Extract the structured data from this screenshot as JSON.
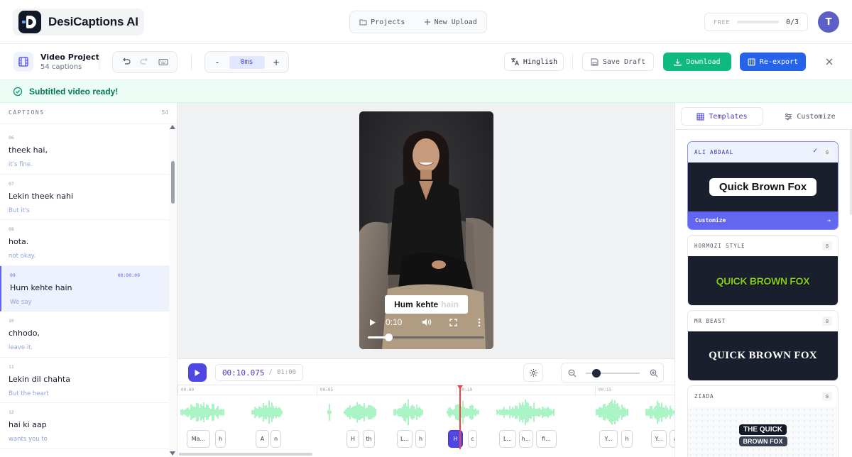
{
  "brand": {
    "name": "DesiCaptions AI"
  },
  "nav": {
    "projects": "Projects",
    "new_upload": "New Upload"
  },
  "quota": {
    "plan": "FREE",
    "count": "0/3",
    "used_fraction": 0
  },
  "user": {
    "initial": "T"
  },
  "project": {
    "title": "Video Project",
    "subtitle": "54 captions"
  },
  "offset": {
    "minus": "-",
    "value": "0ms",
    "plus": "+"
  },
  "toolbar": {
    "language": "Hinglish",
    "save_draft": "Save Draft",
    "download": "Download",
    "reexport": "Re-export"
  },
  "banner": {
    "text": "Subtitled video ready!"
  },
  "captions": {
    "header": "CAPTIONS",
    "count": "54",
    "items": [
      {
        "num": "06",
        "text": "theek hai,",
        "translation": "it's fine.",
        "time": "",
        "active": false
      },
      {
        "num": "07",
        "text": "Lekin theek nahi",
        "translation": "But it's",
        "time": "",
        "active": false
      },
      {
        "num": "08",
        "text": "hota.",
        "translation": "not okay.",
        "time": "",
        "active": false
      },
      {
        "num": "09",
        "text": "Hum kehte hain",
        "translation": "We say",
        "time": "00:00:09",
        "active": true
      },
      {
        "num": "10",
        "text": "chhodo,",
        "translation": "leave it.",
        "time": "",
        "active": false
      },
      {
        "num": "11",
        "text": "Lekin dil chahta",
        "translation": "But the heart",
        "time": "",
        "active": false
      },
      {
        "num": "12",
        "text": "hai ki aap",
        "translation": "wants you to",
        "time": "",
        "active": false
      }
    ]
  },
  "preview": {
    "caption_words": [
      "Hum",
      "kehte",
      "hain"
    ],
    "video_time": "0:10",
    "progress_fraction": 0.18
  },
  "playback": {
    "current": "00:10.075",
    "separator": "/",
    "total": "01:00",
    "zoom_fraction": 0.2
  },
  "timeline": {
    "ticks": [
      "00:00",
      "00:05",
      "00:10",
      "00:15"
    ],
    "chips": [
      {
        "label": "Ma...",
        "active": false
      },
      {
        "label": "h",
        "active": false
      },
      {
        "label": "A",
        "active": false
      },
      {
        "label": "n",
        "active": false
      },
      {
        "label": "H",
        "active": false
      },
      {
        "label": "th",
        "active": false
      },
      {
        "label": "L...",
        "active": false
      },
      {
        "label": "h",
        "active": false
      },
      {
        "label": "H",
        "active": true
      },
      {
        "label": "c",
        "active": false
      },
      {
        "label": "L...",
        "active": false
      },
      {
        "label": "h...",
        "active": false
      },
      {
        "label": "fi...",
        "active": false
      },
      {
        "label": "Y...",
        "active": false
      },
      {
        "label": "h",
        "active": false
      },
      {
        "label": "Y...",
        "active": false
      },
      {
        "label": "a",
        "active": false
      }
    ]
  },
  "templates_panel": {
    "tab_templates": "Templates",
    "tab_customize": "Customize",
    "templates": [
      {
        "name": "ALI ABDAAL",
        "badge": "8",
        "preview_text": "Quick Brown Fox",
        "selected": true,
        "customize_label": "Customize"
      },
      {
        "name": "HORMOZI STYLE",
        "badge": "8",
        "preview_text": "QUICK BROWN FOX",
        "selected": false
      },
      {
        "name": "MR BEAST",
        "badge": "8",
        "preview_text": "QUICK BROWN FOX",
        "selected": false
      },
      {
        "name": "ZIADA",
        "badge": "8",
        "preview_line1": "THE QUICK",
        "preview_line2": "BROWN FOX",
        "selected": false
      }
    ]
  },
  "colors": {
    "accent": "#4f46e5",
    "success": "#10b981",
    "primary": "#2563eb",
    "playhead": "#ef4444",
    "waveform": "#86efac"
  }
}
